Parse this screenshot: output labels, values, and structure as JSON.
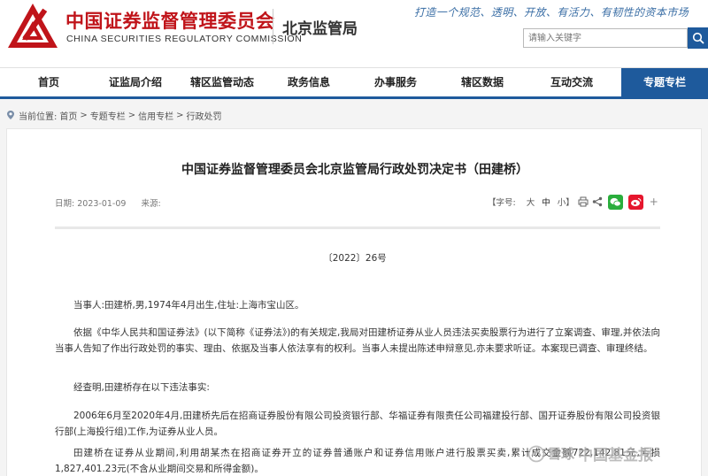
{
  "header": {
    "logo_cn": "中国证券监督管理委员会",
    "logo_en": "CHINA SECURITIES REGULATORY COMMISSION",
    "bureau": "北京监管局",
    "slogan": "打造一个规范、透明、开放、有活力、有韧性的资本市场",
    "search_placeholder": "请输入关键字",
    "brand_color": "#c0141a",
    "accent_color": "#1e5a9c"
  },
  "nav": {
    "items": [
      "首页",
      "证监局介绍",
      "辖区监管动态",
      "政务信息",
      "办事服务",
      "辖区数据",
      "互动交流",
      "专题专栏"
    ],
    "active": "专题专栏"
  },
  "breadcrumb": {
    "prefix": "当前位置:",
    "items": [
      "首页",
      "专题专栏",
      "信用专栏",
      "行政处罚"
    ],
    "separator": ">"
  },
  "article": {
    "title": "中国证券监督管理委员会北京监管局行政处罚决定书（田建桥）",
    "date_label": "日期:",
    "date": "2023-01-09",
    "source_label": "来源:",
    "font_label": "【字号:",
    "font_sizes": [
      "大",
      "中",
      "小"
    ],
    "font_suffix": "】",
    "doc_number": "〔2022〕26号",
    "paragraphs": [
      "当事人:田建桥,男,1974年4月出生,住址:上海市宝山区。",
      "依据《中华人民共和国证券法》(以下简称《证券法》)的有关规定,我局对田建桥证券从业人员违法买卖股票行为进行了立案调查、审理,并依法向当事人告知了作出行政处罚的事实、理由、依据及当事人依法享有的权利。当事人未提出陈述申辩意见,亦未要求听证。本案现已调查、审理终结。",
      "经查明,田建桥存在以下违法事实:",
      "2006年6月至2020年4月,田建桥先后在招商证券股份有限公司投资银行部、华福证券有限责任公司福建投行部、国开证券股份有限公司投资银行部(上海投行组)工作,为证券从业人员。",
      "田建桥在证券从业期间,利用胡某杰在招商证券开立的证券普通账户和证券信用账户进行股票买卖,累计成交金额722,142.81元,亏损1,827,401.23元(不含从业期间交易和所得金额)。"
    ]
  },
  "watermark": {
    "text1": "雪球",
    "text2": "中国基金报"
  }
}
